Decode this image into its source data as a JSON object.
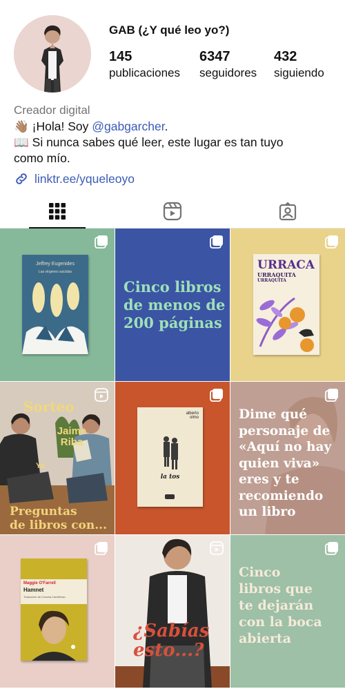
{
  "profile": {
    "username": "GAB (¿Y qué leo yo?)",
    "stats": [
      {
        "count": "145",
        "label": "publicaciones"
      },
      {
        "count": "6347",
        "label": "seguidores"
      },
      {
        "count": "432",
        "label": "siguiendo"
      }
    ],
    "category": "Creador digital",
    "bio_line1_prefix": "👋🏽 ¡Hola! Soy ",
    "bio_mention": "@gabgarcher",
    "bio_line1_suffix": ".",
    "bio_line2": "📖 Si nunca sabes qué leer, este lugar es tan tuyo",
    "bio_line3": "como mío.",
    "link": "linktr.ee/yqueleoyo"
  },
  "tabs": [
    {
      "name": "grid",
      "icon": "grid-icon",
      "active": true
    },
    {
      "name": "reels",
      "icon": "reels-icon",
      "active": false
    },
    {
      "name": "tagged",
      "icon": "tagged-icon",
      "active": false
    }
  ],
  "posts": {
    "p1": {
      "author": "Jeffrey Eugenides",
      "subtitle": "Las vírgenes suicidas",
      "bg": "#86b89a"
    },
    "p2": {
      "text_l1": "Cinco libros",
      "text_l2": "de menos de",
      "text_l3": "200 páginas",
      "bg": "#3b54a4"
    },
    "p3": {
      "title": "URRACA",
      "subtitle": "URRAQUITA",
      "subtitle2": "URRAQUITA",
      "bg": "#e9d28a"
    },
    "p4": {
      "sorteo": "Sorteo",
      "jaime": "Jaime Riba",
      "yo": "Yo",
      "bottom_l1": "Preguntas",
      "bottom_l2": "de libros con..."
    },
    "p5": {
      "author": "alberto olmo",
      "title": "la tos",
      "bg": "#c8552c"
    },
    "p6": {
      "l1": "Dime qué",
      "l2": "personaje de",
      "l3": "«Aquí no hay",
      "l4": "quien viva»",
      "l5": "eres y te",
      "l6": "recomiendo",
      "l7": "un libro"
    },
    "p7": {
      "author": "Maggie O'Farrell",
      "title": "Hamnet",
      "translator": "Traducción de Concha Cardeñoso",
      "bg": "#e9cfc8"
    },
    "p8": {
      "l1": "¿Sabías",
      "l2": "esto...?"
    },
    "p9": {
      "l1": "Cinco",
      "l2": "libros que",
      "l3": "te dejarán",
      "l4": "con la boca",
      "l5": "abierta",
      "bg": "#9dc0a7"
    }
  },
  "colors": {
    "link": "#3b5bb5",
    "category": "#737373"
  }
}
